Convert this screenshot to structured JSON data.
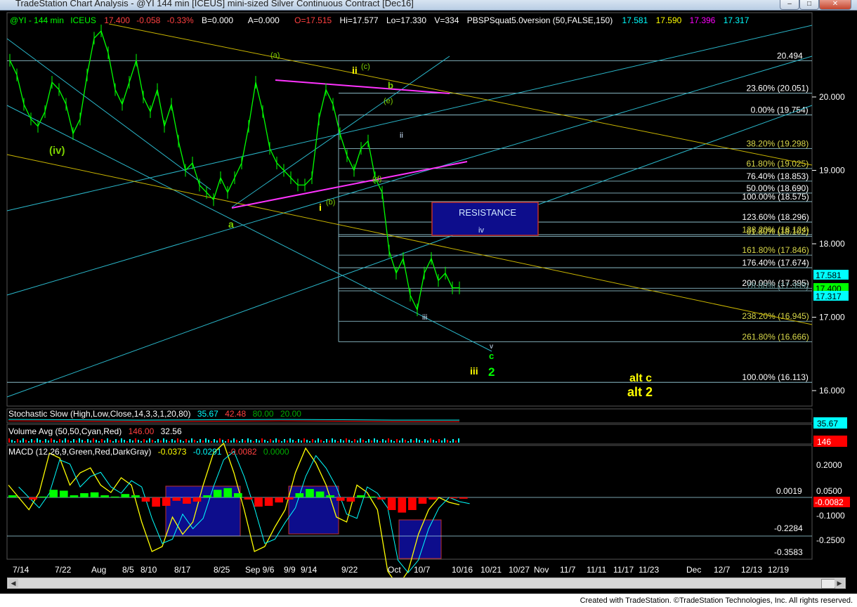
{
  "window": {
    "title": "TradeStation Chart Analysis - @YI 144 min [ICEUS] mini-sized Silver Continuous Contract [Dec16]",
    "buttons": [
      "minimize",
      "maximize",
      "close"
    ]
  },
  "header": {
    "symbol": "@YI - 144 min",
    "exchange": "ICEUS",
    "last": "17.400",
    "change": "-0.058",
    "pct_change": "-0.33%",
    "bid": "B=0.000",
    "ask": "A=0.000",
    "open": "O=17.515",
    "high": "Hi=17.577",
    "low": "Lo=17.330",
    "volume": "V=334",
    "study": "PBSPSquat5.0version (50,FALSE,150)",
    "study_values": [
      "17.581",
      "17.590",
      "17.396",
      "17.317"
    ]
  },
  "colors": {
    "price": "#00ff00",
    "yellow": "#ffff00",
    "cyan": "#00ffff",
    "magenta": "#ff00ff",
    "red": "#ff0000",
    "fib_line": "#9fd8e6",
    "trend_cyan": "#2ab6c9",
    "trend_yellow": "#c8b400",
    "resistance_fill": "#0d0d8c",
    "resistance_border": "#c0302a"
  },
  "price_axis": {
    "ticks": [
      "20.000",
      "19.000",
      "18.000",
      "17.000",
      "16.000"
    ]
  },
  "price_tags": [
    {
      "label": "17.581",
      "bg": "#00ffff",
      "fg": "#000000"
    },
    {
      "label": "17.400",
      "bg": "#00ff00",
      "fg": "#000000"
    },
    {
      "label": "17.317",
      "bg": "#00ffff",
      "fg": "#000000"
    }
  ],
  "date_axis": [
    "7/14",
    "7/22",
    "Aug",
    "8/5",
    "8/10",
    "8/17",
    "8/25",
    "Sep 9/6",
    "9/9",
    "9/14",
    "9/22",
    "Oct",
    "10/7",
    "10/16",
    "10/21",
    "10/27",
    "Nov",
    "11/7",
    "11/11",
    "11/17",
    "11/23",
    "Dec",
    "12/7",
    "12/13",
    "12/19"
  ],
  "fib_labels": [
    {
      "text": "20.494",
      "value": 20.494
    },
    {
      "text": "23.60% (20.051)",
      "value": 20.051
    },
    {
      "text": "0.00% (19.754)",
      "value": 19.754
    },
    {
      "text": "38.20% (19.298)",
      "value": 19.298
    },
    {
      "text": "61.80% (19.025)",
      "value": 19.025
    },
    {
      "text": "76.40% (18.853)",
      "value": 18.853
    },
    {
      "text": "50.00% (18.690)",
      "value": 18.69
    },
    {
      "text": "100.00% (18.575)",
      "value": 18.575
    },
    {
      "text": "123.60% (18.296)",
      "value": 18.296
    },
    {
      "text": "138.20% (18.124)",
      "value": 18.124
    },
    {
      "text": "61.80% (18.102)",
      "value": 18.102
    },
    {
      "text": "161.80% (17.846)",
      "value": 17.846
    },
    {
      "text": "176.40% (17.674)",
      "value": 17.674
    },
    {
      "text": "200.00% (17.395)",
      "value": 17.395
    },
    {
      "text": "78.60% (17.359)",
      "value": 17.359
    },
    {
      "text": "238.20% (16.945)",
      "value": 16.945
    },
    {
      "text": "261.80% (16.666)",
      "value": 16.666
    },
    {
      "text": "100.00% (16.113)",
      "value": 16.113
    }
  ],
  "resistance_box": {
    "label": "RESISTANCE"
  },
  "wave_labels": [
    {
      "text": "(iv)",
      "color": "#7cd000"
    },
    {
      "text": "(a)",
      "color": "#7cd000"
    },
    {
      "text": "ii",
      "color": "#ffff00"
    },
    {
      "text": "(c)",
      "color": "#7cd000"
    },
    {
      "text": "b",
      "color": "#7cd000"
    },
    {
      "text": "(e)",
      "color": "#7cd000"
    },
    {
      "text": "ii",
      "color": "#cfe6ff"
    },
    {
      "text": "(d)",
      "color": "#7cd000"
    },
    {
      "text": "i",
      "color": "#ffff00"
    },
    {
      "text": "(b)",
      "color": "#7cd000"
    },
    {
      "text": "a",
      "color": "#7cd000"
    },
    {
      "text": "iv",
      "color": "#cfe6ff"
    },
    {
      "text": "iii",
      "color": "#cfe6ff"
    },
    {
      "text": "v",
      "color": "#cfe6ff"
    },
    {
      "text": "c",
      "color": "#00ff00"
    },
    {
      "text": "iii",
      "color": "#ffff00"
    },
    {
      "text": "2",
      "color": "#00ff00"
    },
    {
      "text": "alt c",
      "color": "#ffff00"
    },
    {
      "text": "alt 2",
      "color": "#ffff00"
    }
  ],
  "stochastic": {
    "label": "Stochastic Slow (High,Low,Close,14,3,3,1,20,80)",
    "values": [
      "35.67",
      "42.48",
      "80.00",
      "20.00"
    ],
    "tag": "35.67"
  },
  "volume": {
    "label": "Volume Avg (50,50,Cyan,Red)",
    "values": [
      "146.00",
      "32.56"
    ],
    "tag": "146"
  },
  "macd": {
    "label": "MACD (12,26,9,Green,Red,DarkGray)",
    "values": [
      "-0.0373",
      "-0.0291",
      "-0.0082",
      "0.0000"
    ],
    "axis_ticks": [
      "0.2000",
      "0.0500",
      "-0.1000",
      "-0.2500"
    ],
    "levels": [
      "0.0019",
      "-0.2284",
      "-0.3583"
    ],
    "tag": "-0.0082"
  },
  "footer": "Created with TradeStation. ©TradeStation Technologies, Inc. All rights reserved.",
  "chart_data": {
    "type": "line",
    "symbol": "@YI",
    "interval": "144 min",
    "x_axis": [
      "7/14",
      "7/22",
      "Aug",
      "8/5",
      "8/10",
      "8/17",
      "8/25",
      "Sep 9/6",
      "9/9",
      "9/14",
      "9/22",
      "Oct",
      "10/7",
      "10/16",
      "10/21",
      "10/27",
      "Nov",
      "11/7",
      "11/11",
      "11/17",
      "11/23",
      "Dec",
      "12/7",
      "12/13",
      "12/19"
    ],
    "y_ticks": [
      20,
      19,
      18,
      17,
      16
    ],
    "ylim": [
      15.6,
      20.95
    ],
    "series": [
      {
        "values": [
          20.5,
          20.3,
          19.9,
          19.7,
          19.6,
          19.8,
          20.2,
          20.1,
          19.9,
          19.5,
          19.7,
          20.3,
          20.8,
          20.9,
          20.6,
          20.1,
          19.9,
          20.2,
          20.5,
          20.0,
          19.8,
          20.1,
          19.6,
          19.9,
          19.4,
          19.0,
          19.1,
          18.8,
          18.7,
          18.6,
          18.9,
          18.7,
          18.9,
          19.1,
          19.6,
          20.2,
          19.8,
          19.3,
          19.1,
          19.0,
          18.9,
          18.8,
          18.8,
          18.9,
          19.7,
          20.1,
          19.9,
          19.5,
          19.2,
          19.0,
          19.3,
          19.4,
          18.9,
          18.7,
          17.9,
          17.6,
          17.8,
          17.3,
          17.1,
          17.6,
          17.8,
          17.5,
          17.6,
          17.4,
          17.4
        ]
      }
    ],
    "pivots": [
      {
        "label": "(iv)",
        "value": 19.35
      },
      {
        "label": "(a)",
        "value": 20.2
      },
      {
        "label": "ii",
        "value": 20.15
      },
      {
        "label": "b",
        "value": 19.8
      },
      {
        "label": "a",
        "value": 18.55
      },
      {
        "label": "i",
        "value": 18.6
      },
      {
        "label": "iii",
        "value": 17.1
      }
    ]
  }
}
